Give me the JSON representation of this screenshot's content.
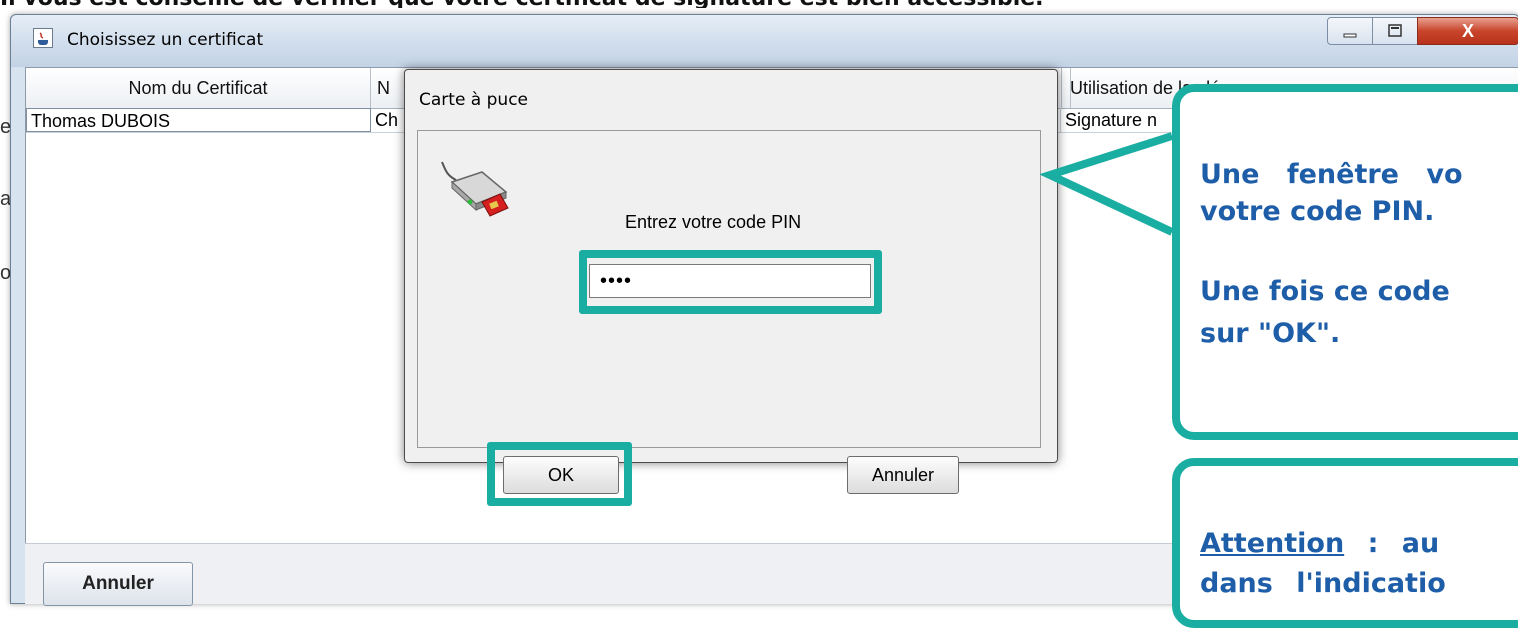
{
  "background": {
    "heading": "Il vous est conseillé de vérifier que votre certificat de signature est bien accessible.",
    "side_letters": [
      "e",
      "a",
      "o"
    ]
  },
  "window": {
    "title": "Choisissez un certificat",
    "controls": {
      "minimize": "—",
      "maximize": "□",
      "close": "X"
    },
    "table": {
      "columns": [
        "Nom du Certificat",
        "N",
        "Utilisation de la clé"
      ],
      "rows": [
        {
          "name": "Thomas DUBOIS",
          "col2": "Ch",
          "usage": "Signature n"
        }
      ]
    },
    "cancel_button": "Annuler"
  },
  "dialog": {
    "title": "Carte à puce",
    "icon": "smart-card-reader-icon",
    "prompt": "Entrez votre code PIN",
    "pin_value": "••••",
    "ok_button": "OK",
    "cancel_button": "Annuler"
  },
  "callouts": {
    "first": {
      "line1": "Une fenêtre vo",
      "line2": "votre code PIN.",
      "line3": "Une fois ce code",
      "line4": "sur \"OK\"."
    },
    "second": {
      "line1_underlined": "Attention",
      "line1_rest": " : au",
      "line2": "dans l'indicatio"
    }
  },
  "colors": {
    "highlight": "#1aaea2",
    "callout_text": "#1e5ea8"
  }
}
